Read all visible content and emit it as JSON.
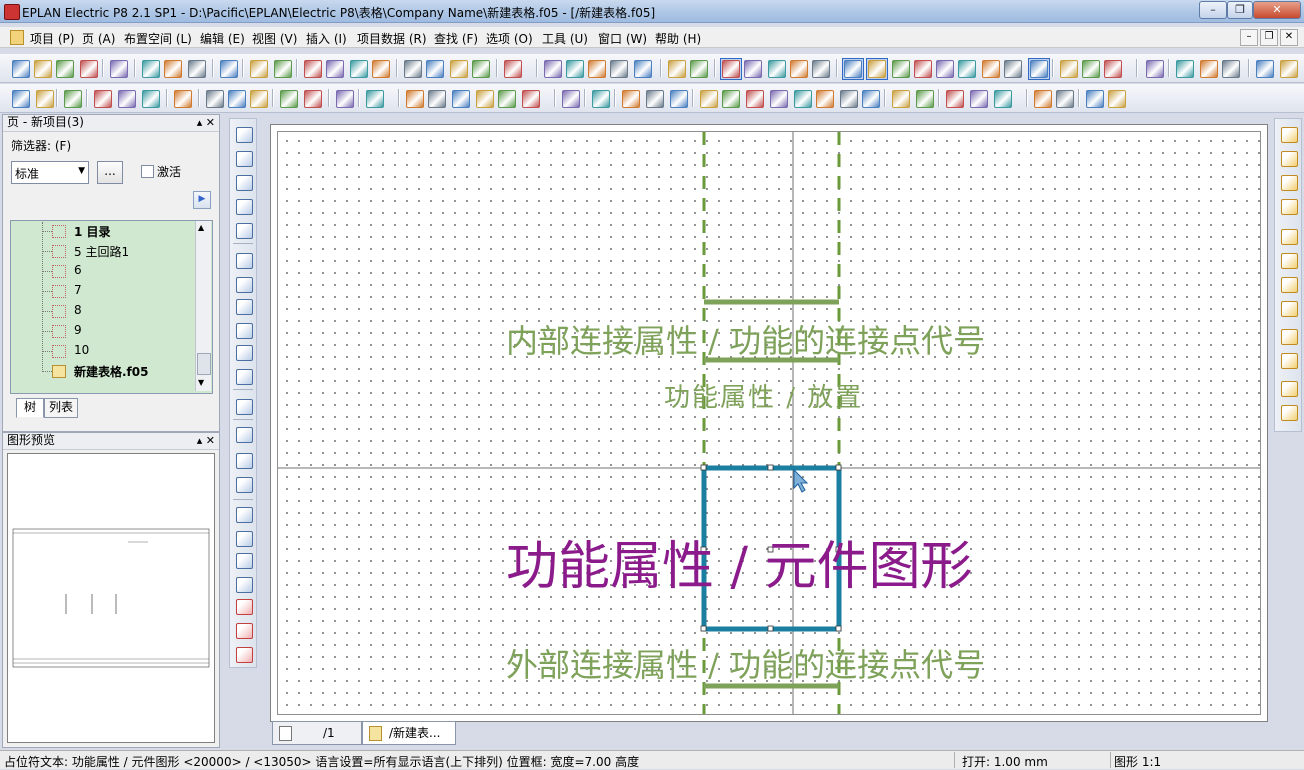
{
  "window": {
    "title": "EPLAN Electric P8 2.1 SP1 - D:\\Pacific\\EPLAN\\Electric P8\\表格\\Company Name\\新建表格.f05 - [/新建表格.f05]"
  },
  "menu": {
    "items": [
      "项目 (P)",
      "页 (A)",
      "布置空间 (L)",
      "编辑 (E)",
      "视图 (V)",
      "插入 (I)",
      "项目数据 (R)",
      "查找 (F)",
      "选项 (O)",
      "工具 (U)",
      "窗口 (W)",
      "帮助 (H)"
    ]
  },
  "page_navigator": {
    "title": "页 - 新项目(3)",
    "filter_label": "筛选器: (F)",
    "filter_value": "标准",
    "more_button": "...",
    "activate_label": "激活",
    "tree_items": [
      "1 目录",
      "5 主回路1",
      "6",
      "7",
      "8",
      "9",
      "10",
      "新建表格.f05"
    ],
    "tabs": [
      "树",
      "列表"
    ]
  },
  "preview_panel": {
    "title": "图形预览"
  },
  "canvas": {
    "texts": {
      "internal_conn": "内部连接属性 / 功能的连接点代号",
      "func_place": "功能属性 / 放置",
      "func_symbol": "功能属性 / 元件图形",
      "external_conn": "外部连接属性 / 功能的连接点代号"
    },
    "colors": {
      "green_text": "#7fa25a",
      "purple_text": "#8b1a8b",
      "symbol_blue": "#1a7fa0",
      "dashed_green": "#6a9a3a"
    }
  },
  "doc_tabs": [
    "/1",
    "/新建表..."
  ],
  "status": {
    "left": "占位符文本: 功能属性 / 元件图形 <20000> / <13050> 语言设置=所有显示语言(上下排列) 位置框: 宽度=7.00 高度",
    "open": "打开: 1.00 mm",
    "graphic": "图形 1:1"
  }
}
